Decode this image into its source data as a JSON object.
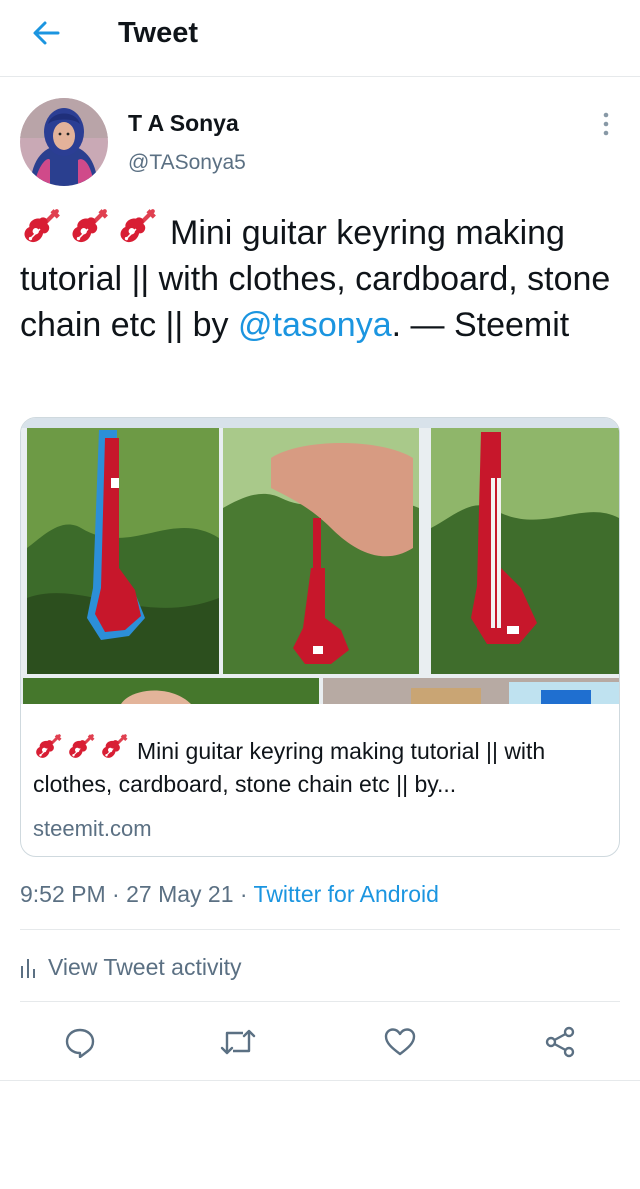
{
  "header": {
    "title": "Tweet"
  },
  "author": {
    "name": "T A Sonya",
    "handle": "@TASonya5"
  },
  "tweet": {
    "text_before": "Mini  guitar keyring making tutorial || with clothes, cardboard, stone chain etc || by ",
    "mention": "@tasonya",
    "text_after": ". — Steemit",
    "emoji_icons": [
      "guitar-icon",
      "guitar-icon",
      "guitar-icon"
    ]
  },
  "card": {
    "title": "Mini guitar keyring making tutorial || with clothes, cardboard, stone chain etc || by...",
    "domain": "steemit.com"
  },
  "meta": {
    "time": "9:52 PM",
    "separator": " · ",
    "date": "27 May 21",
    "source": "Twitter for Android"
  },
  "activity": {
    "label": "View Tweet activity"
  },
  "colors": {
    "accent": "#1b95e0",
    "muted": "#5b7083",
    "guitar_red": "#d81e34"
  }
}
